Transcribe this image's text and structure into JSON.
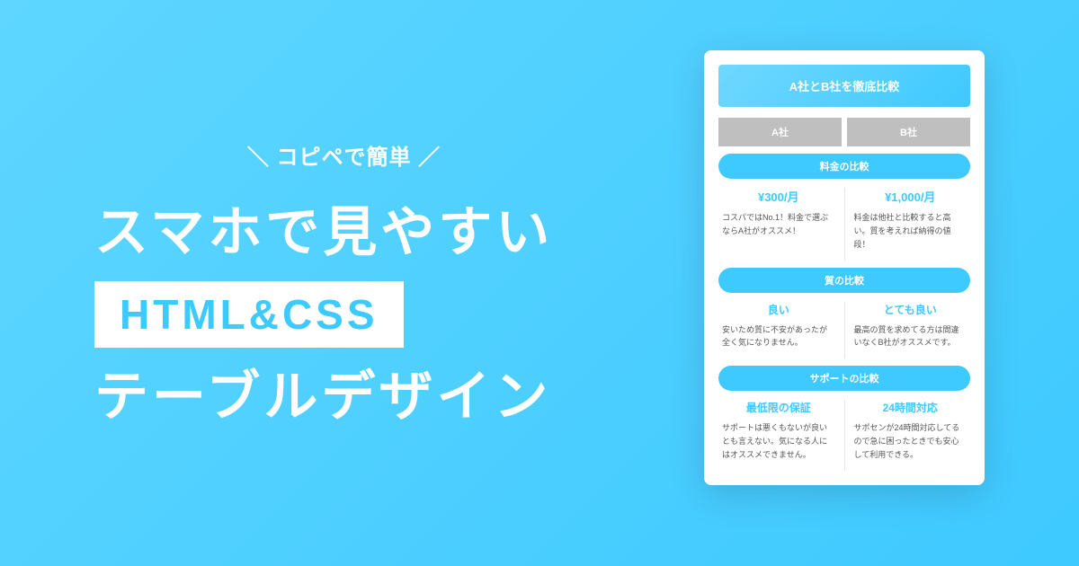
{
  "hero": {
    "tagline": "＼ コピペで簡単 ／",
    "headline1": "スマホで見やすい",
    "badge": "HTML&CSS",
    "headline2": "テーブルデザイン"
  },
  "card": {
    "title": "A社とB社を徹底比較",
    "columns": {
      "a": "A社",
      "b": "B社"
    },
    "sections": [
      {
        "label": "料金の比較",
        "a": {
          "highlight": "¥300/月",
          "desc": "コスパではNo.1！料金で選ぶならA社がオススメ！"
        },
        "b": {
          "highlight": "¥1,000/月",
          "desc": "料金は他社と比較すると高い。質を考えれば納得の値段！"
        }
      },
      {
        "label": "質の比較",
        "a": {
          "highlight": "良い",
          "desc": "安いため質に不安があったが全く気になりません。"
        },
        "b": {
          "highlight": "とても良い",
          "desc": "最高の質を求めてる方は間違いなくB社がオススメです。"
        }
      },
      {
        "label": "サポートの比較",
        "a": {
          "highlight": "最低限の保証",
          "desc": "サポートは悪くもないが良いとも言えない。気になる人にはオススメできません。"
        },
        "b": {
          "highlight": "24時間対応",
          "desc": "サポセンが24時間対応してるので急に困ったときでも安心して利用できる。"
        }
      }
    ]
  }
}
